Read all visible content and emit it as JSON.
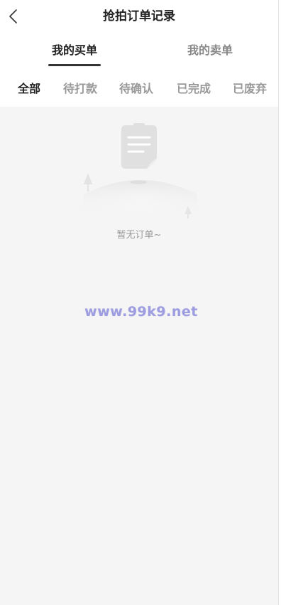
{
  "header": {
    "title": "抢拍订单记录",
    "back_icon": "chevron-left-icon"
  },
  "main_tabs": [
    {
      "label": "我的买单",
      "active": true
    },
    {
      "label": "我的卖单",
      "active": false
    }
  ],
  "status_tabs": [
    {
      "label": "全部",
      "active": true
    },
    {
      "label": "待打款",
      "active": false
    },
    {
      "label": "待确认",
      "active": false
    },
    {
      "label": "已完成",
      "active": false
    },
    {
      "label": "已废弃",
      "active": false
    }
  ],
  "empty_state": {
    "icon": "empty-document-icon",
    "message": "暂无订单~"
  },
  "watermark": "www.99k9.net",
  "colors": {
    "background": "#f5f5f5",
    "header_bg": "#ffffff",
    "active_text": "#222222",
    "inactive_text": "#999999",
    "tab_indicator": "#333333",
    "watermark": "#9d9de0"
  }
}
